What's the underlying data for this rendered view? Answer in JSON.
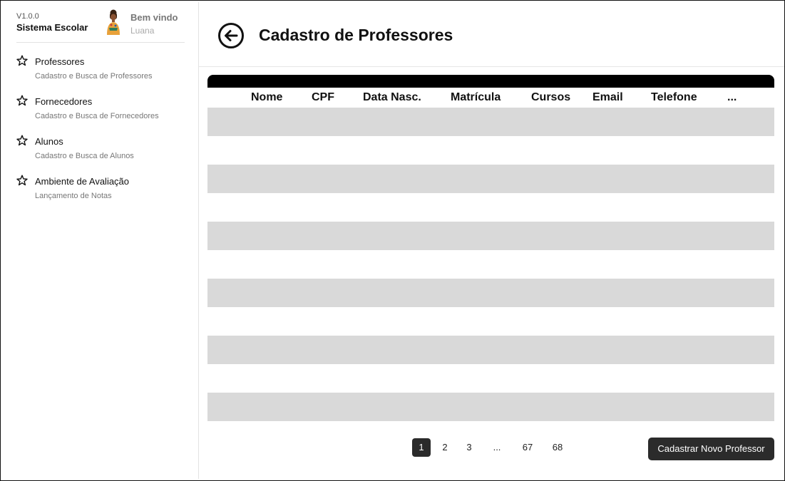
{
  "app": {
    "version": "V1.0.0",
    "name": "Sistema Escolar"
  },
  "user": {
    "greeting": "Bem vindo",
    "name": "Luana"
  },
  "sidebar": {
    "items": [
      {
        "label": "Professores",
        "sub": "Cadastro e Busca de Professores",
        "icon": "star-icon"
      },
      {
        "label": "Fornecedores",
        "sub": "Cadastro e Busca de Fornecedores",
        "icon": "star-icon"
      },
      {
        "label": "Alunos",
        "sub": "Cadastro e Busca de Alunos",
        "icon": "star-icon"
      },
      {
        "label": "Ambiente de Avaliação",
        "sub": "Lançamento de Notas",
        "icon": "star-icon"
      }
    ]
  },
  "header": {
    "title": "Cadastro de Professores",
    "back_icon": "arrow-left-circle-icon"
  },
  "table": {
    "columns": [
      "Nome",
      "CPF",
      "Data Nasc.",
      "Matrícula",
      "Cursos",
      "Email",
      "Telefone",
      "..."
    ],
    "rows": [
      [],
      [],
      [],
      [],
      [],
      []
    ]
  },
  "pagination": {
    "pages": [
      "1",
      "2",
      "3",
      "...",
      "67",
      "68"
    ],
    "current": "1"
  },
  "actions": {
    "create_label": "Cadastrar Novo Professor"
  },
  "colors": {
    "accent": "#2b2b2b",
    "row_fill": "#d9d9d9",
    "table_header_bar": "#000000"
  }
}
